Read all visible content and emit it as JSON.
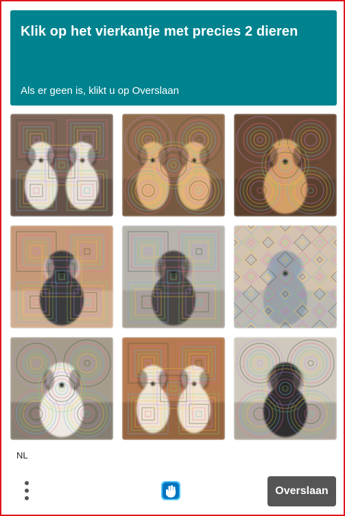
{
  "header": {
    "title": "Klik op het vierkantje met precies 2 dieren",
    "subtitle": "Als er geen is, klikt u op Overslaan"
  },
  "tiles": [
    {
      "subject": "two-white-dogs",
      "bg": "#7c6556",
      "fur": "#e9e3d9",
      "accent": "#3a3030",
      "count": 2,
      "pattern": "squares"
    },
    {
      "subject": "two-golden-puppies",
      "bg": "#8f6b4c",
      "fur": "#e1b17c",
      "accent": "#4a3a2a",
      "count": 2,
      "pattern": "circles"
    },
    {
      "subject": "golden-puppy",
      "bg": "#6a4a35",
      "fur": "#d5a066",
      "accent": "#3d2a1e",
      "count": 1,
      "pattern": "circles"
    },
    {
      "subject": "black-dog-on-couch",
      "bg": "#c69a79",
      "fur": "#3b3b3d",
      "accent": "#e4d3c2",
      "count": 1,
      "pattern": "squares"
    },
    {
      "subject": "bird-by-window",
      "bg": "#b7b4ad",
      "fur": "#4a4644",
      "accent": "#8a7a6a",
      "count": 1,
      "pattern": "squares"
    },
    {
      "subject": "seagull-on-sand",
      "bg": "#d4c3b0",
      "fur": "#9aa0a6",
      "accent": "#8fa8ba",
      "count": 1,
      "pattern": "diamonds"
    },
    {
      "subject": "white-dog",
      "bg": "#a59c8c",
      "fur": "#eeeae3",
      "accent": "#4e4840",
      "count": 1,
      "pattern": "circles"
    },
    {
      "subject": "two-beagles",
      "bg": "#b57a4f",
      "fur": "#f0e3d2",
      "accent": "#5a3b26",
      "count": 2,
      "pattern": "squares"
    },
    {
      "subject": "black-cat-by-window",
      "bg": "#cfc8bc",
      "fur": "#2f2d2e",
      "accent": "#6d655d",
      "count": 1,
      "pattern": "circles"
    }
  ],
  "footer": {
    "language": "NL",
    "menu_icon": "more-vertical-icon",
    "logo_icon": "hcaptcha-hand-logo",
    "skip_label": "Overslaan"
  },
  "colors": {
    "header_bg": "#00838f",
    "skip_bg": "#555555",
    "border": "#e0131a"
  }
}
